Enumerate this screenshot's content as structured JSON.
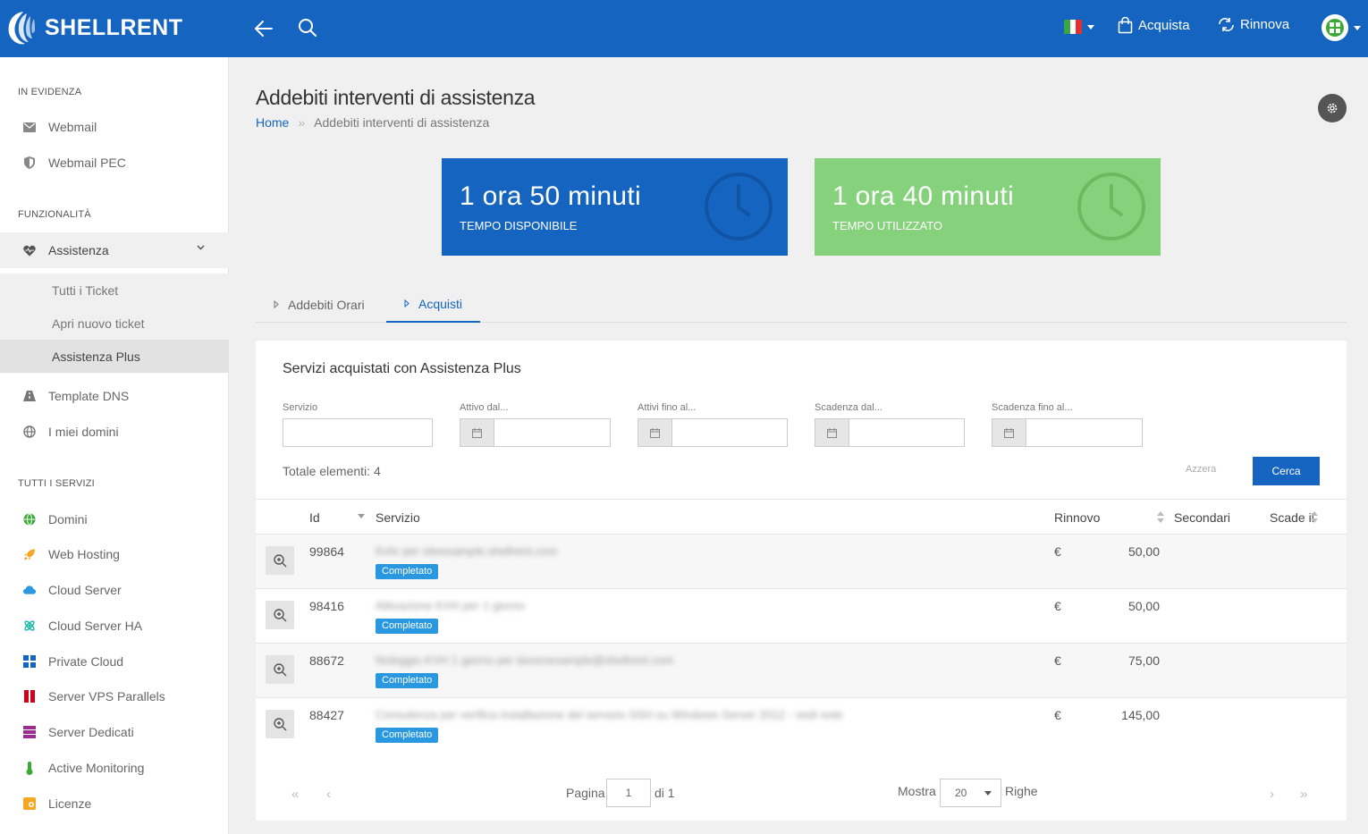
{
  "app": {
    "brand": "SHELLRENT"
  },
  "topbar": {
    "buy_label": "Acquista",
    "renew_label": "Rinnova"
  },
  "sidebar": {
    "section_featured": "IN EVIDENZA",
    "featured": [
      {
        "label": "Webmail",
        "icon": "envelope-icon"
      },
      {
        "label": "Webmail PEC",
        "icon": "shield-icon"
      }
    ],
    "section_features": "FUNZIONALITÀ",
    "assistenza": {
      "label": "Assistenza",
      "icon": "heart-pulse-icon"
    },
    "assistenza_sub": [
      "Tutti i Ticket",
      "Apri nuovo ticket",
      "Assistenza Plus"
    ],
    "features": [
      {
        "label": "Template DNS",
        "icon": "road-icon"
      },
      {
        "label": "I miei domini",
        "icon": "globe-icon"
      }
    ],
    "section_services": "TUTTI I SERVIZI",
    "services": [
      {
        "label": "Domini",
        "icon": "globe-icon",
        "color": "#3aaa35"
      },
      {
        "label": "Web Hosting",
        "icon": "rocket-icon",
        "color": "#f5a623"
      },
      {
        "label": "Cloud Server",
        "icon": "cloud-icon",
        "color": "#2a98e0"
      },
      {
        "label": "Cloud Server HA",
        "icon": "atom-icon",
        "color": "#1ab5a8"
      },
      {
        "label": "Private Cloud",
        "icon": "grid-icon",
        "color": "#1565c0"
      },
      {
        "label": "Server VPS Parallels",
        "icon": "parallels-icon",
        "color": "#d0021b"
      },
      {
        "label": "Server Dedicati",
        "icon": "server-icon",
        "color": "#9b2d8f"
      },
      {
        "label": "Active Monitoring",
        "icon": "thermometer-icon",
        "color": "#3aaa35"
      },
      {
        "label": "Licenze",
        "icon": "license-icon",
        "color": "#f5a623"
      }
    ]
  },
  "page": {
    "title": "Addebiti interventi di assistenza",
    "breadcrumb_home": "Home",
    "breadcrumb_sep": "»",
    "breadcrumb_current": "Addebiti interventi di assistenza"
  },
  "stats": [
    {
      "value": "1 ora 50 minuti",
      "label": "TEMPO DISPONIBILE",
      "color": "#1565c0"
    },
    {
      "value": "1 ora 40 minuti",
      "label": "TEMPO UTILIZZATO",
      "color": "#86d27c"
    }
  ],
  "tabs": [
    {
      "label": "Addebiti Orari",
      "active": false
    },
    {
      "label": "Acquisti",
      "active": true
    }
  ],
  "panel": {
    "title": "Servizi acquistati con Assistenza Plus",
    "filters": {
      "servizio": "Servizio",
      "attivo_dal": "Attivo dal...",
      "attivi_fino": "Attivi fino al...",
      "scadenza_dal": "Scadenza dal...",
      "scadenza_fino": "Scadenza fino al..."
    },
    "total": "Totale elementi: 4",
    "reset_label": "Azzera",
    "search_label": "Cerca",
    "columns": {
      "id": "Id",
      "servizio": "Servizio",
      "rinnovo": "Rinnovo",
      "secondari": "Secondari",
      "scade": "Scade il"
    },
    "rows": [
      {
        "id": "99864",
        "servizio": "Kvhr per sitoexample.shellrent.com",
        "status": "Completato",
        "currency": "€",
        "amount": "50,00"
      },
      {
        "id": "98416",
        "servizio": "Attivazione KVH per 1 giorno",
        "status": "Completato",
        "currency": "€",
        "amount": "50,00"
      },
      {
        "id": "88672",
        "servizio": "Noleggio KVH 1 giorno per lavoroexample@shellrent.com",
        "status": "Completato",
        "currency": "€",
        "amount": "75,00"
      },
      {
        "id": "88427",
        "servizio": "Consulenza per verifica installazione del servizio SSH su Windows Server 2012 - vedi note",
        "status": "Completato",
        "currency": "€",
        "amount": "145,00"
      }
    ],
    "pager": {
      "page_label": "Pagina",
      "page_value": "1",
      "of_label": "di 1",
      "show_label": "Mostra",
      "rows_value": "20",
      "rows_label": "Righe"
    }
  }
}
